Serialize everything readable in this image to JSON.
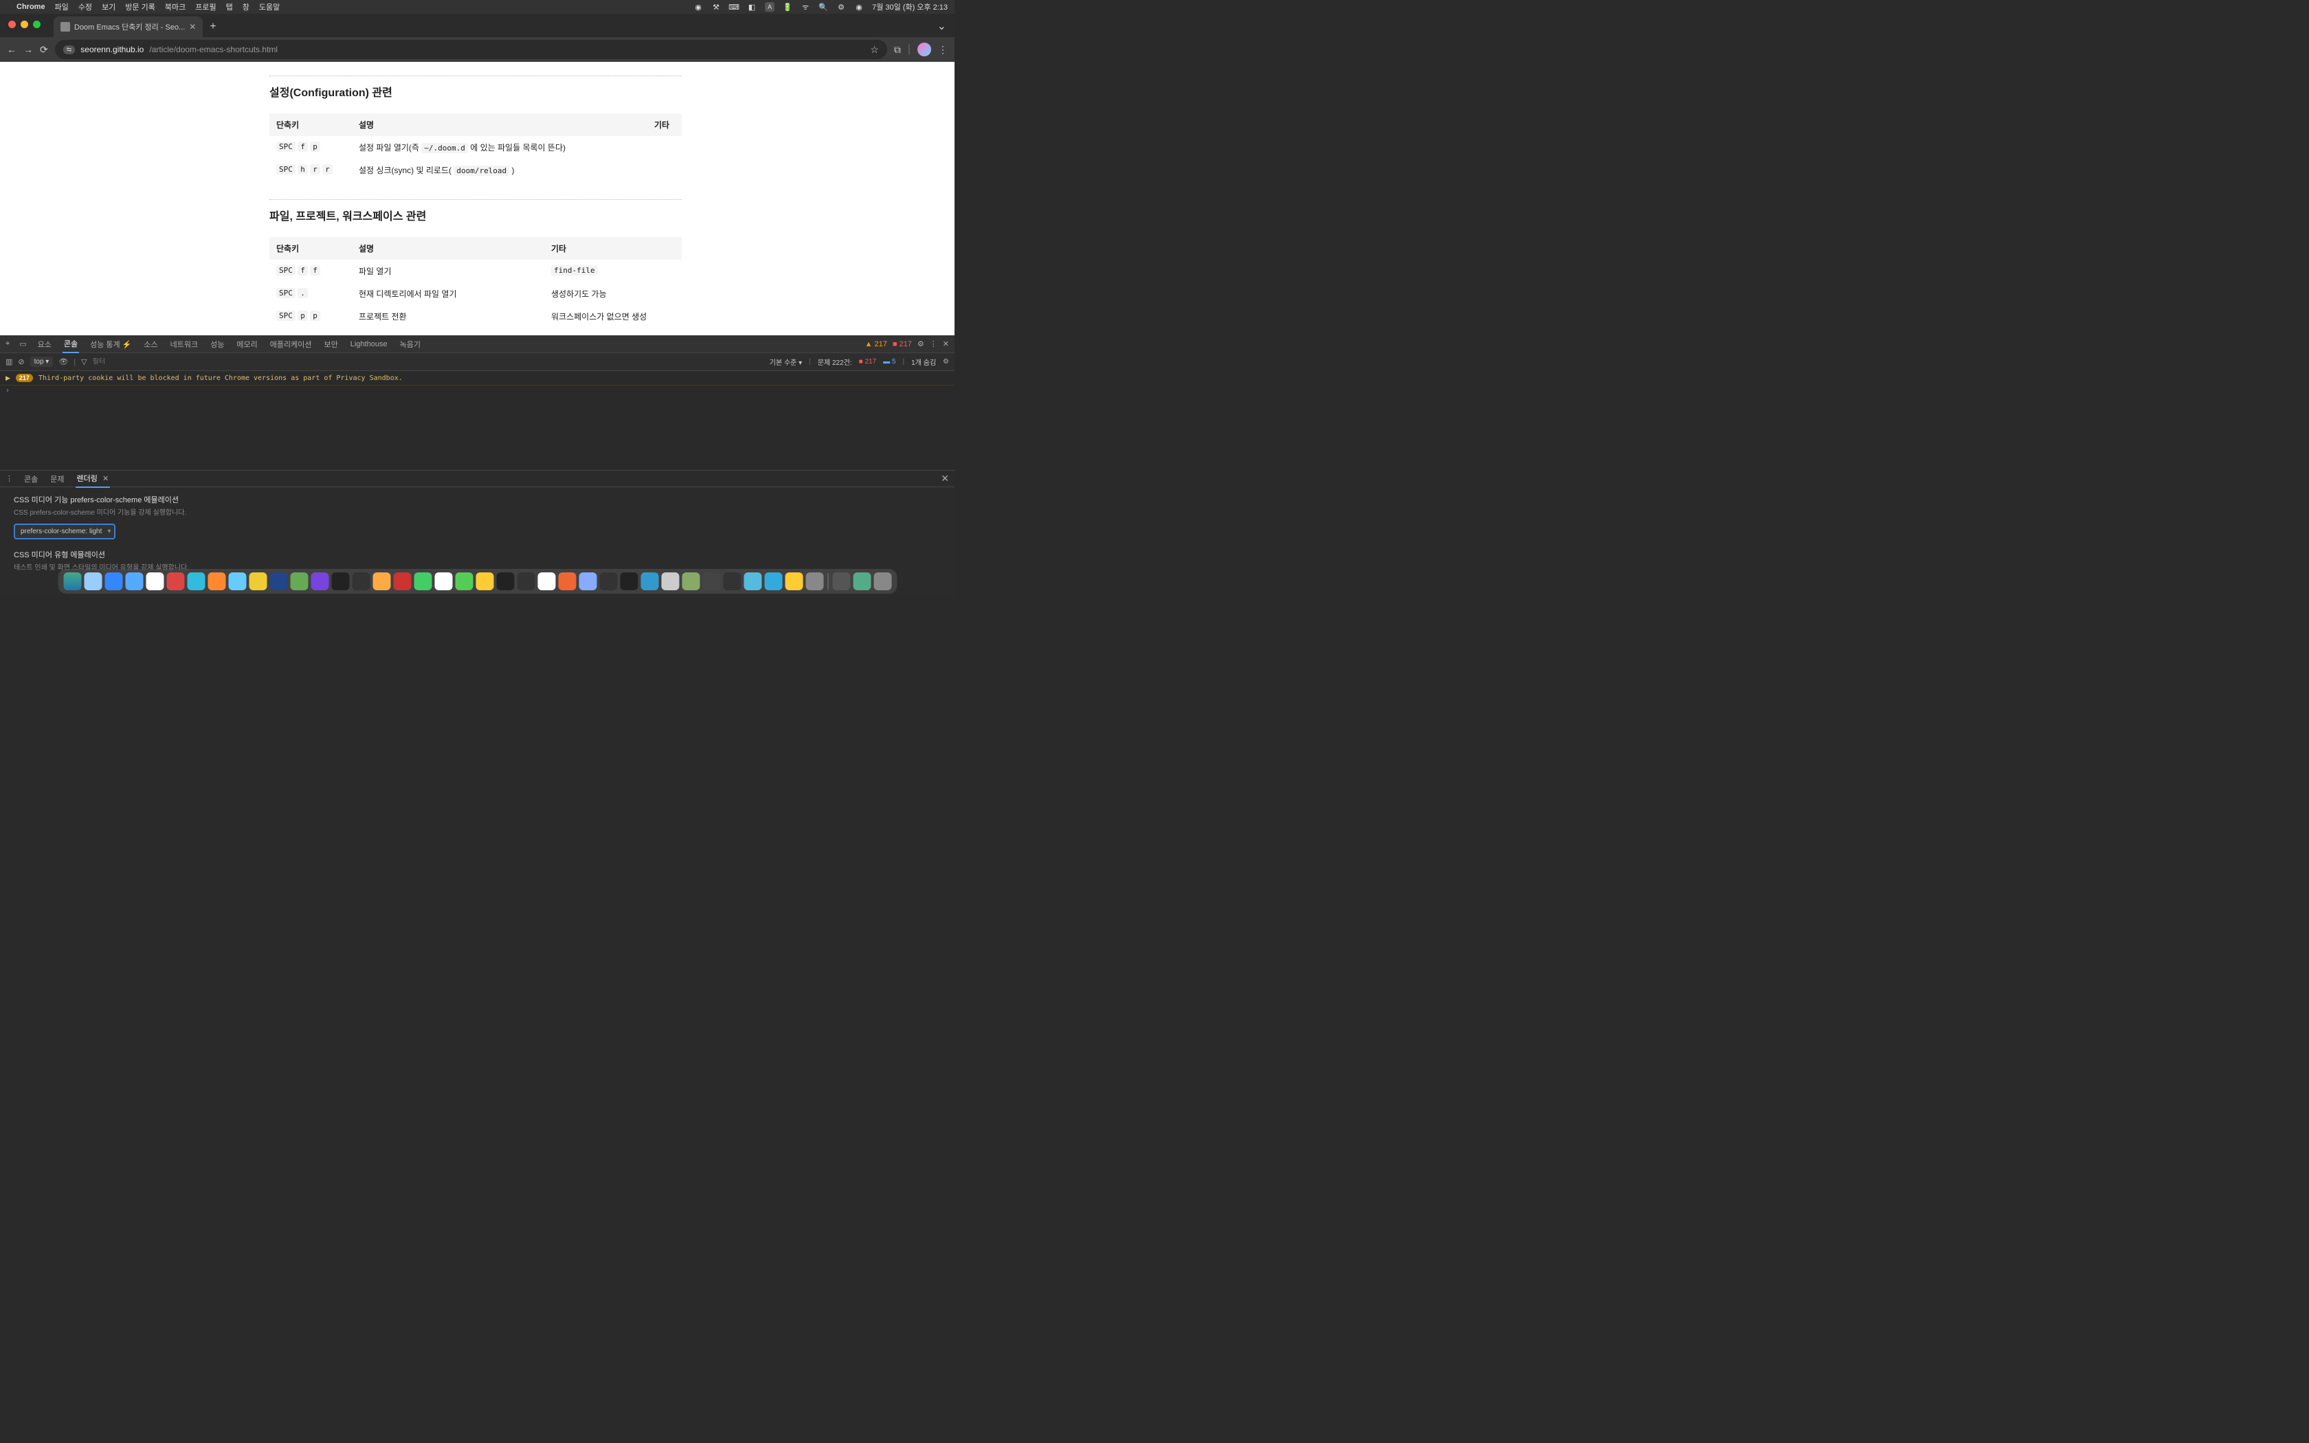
{
  "macos_menubar": {
    "app": "Chrome",
    "items": [
      "파일",
      "수정",
      "보기",
      "방문 기록",
      "북마크",
      "프로필",
      "탭",
      "창",
      "도움말"
    ],
    "clock": "7월 30일 (화) 오후 2:13",
    "input_badge": "A"
  },
  "browser": {
    "tab_title": "Doom Emacs 단축키 정리 - Seo...",
    "url_host": "seorenn.github.io",
    "url_path": "/article/doom-emacs-shortcuts.html"
  },
  "page": {
    "section1_title": "설정(Configuration) 관련",
    "section2_title": "파일, 프로젝트, 워크스페이스 관련",
    "table_headers": {
      "shortcut": "단축키",
      "desc": "설명",
      "misc": "기타"
    },
    "t1": [
      {
        "k_pre": "SPC",
        "k1": "f",
        "k2": "p",
        "d_pre": "설정 파일 열기(즉 ",
        "d_code": "~/.doom.d",
        "d_post": " 에 있는 파일들 목록이 뜬다)",
        "m": ""
      },
      {
        "k_pre": "SPC",
        "k1": "h",
        "k2": "r",
        "k3": "r",
        "d_pre": "설정 싱크(sync) 및 리로드( ",
        "d_code": "doom/reload",
        "d_post": " )",
        "m": ""
      }
    ],
    "t2": [
      {
        "k_pre": "SPC",
        "k1": "f",
        "k2": "f",
        "d": "파일 열기",
        "m_code": "find-file"
      },
      {
        "k_pre": "SPC",
        "k1": ".",
        "d": "현재 디렉토리에서 파일 열기",
        "m": "생성하기도 가능"
      },
      {
        "k_pre": "SPC",
        "k1": "p",
        "k2": "p",
        "d": "프로젝트 전환",
        "m": "워크스페이스가 없으면 생성"
      }
    ]
  },
  "devtools": {
    "tabs": [
      "요소",
      "콘솔",
      "성능 통계 ⚡",
      "소스",
      "네트워크",
      "성능",
      "메모리",
      "애플리케이션",
      "보안",
      "Lighthouse",
      "녹음기"
    ],
    "active_tab": "콘솔",
    "warn_count": "217",
    "err_count": "217",
    "sub": {
      "context": "top ▾",
      "filter_placeholder": "필터",
      "default_label": "기본 수준 ▾",
      "problems_prefix": "문제 222건:",
      "problems_err": "217",
      "problems_msg": "5",
      "hidden": "1개 숨김"
    },
    "msg_badge": "217",
    "msg_text": "Third-party cookie will be blocked in future Chrome versions as part of Privacy Sandbox.",
    "drawer_tabs": [
      "콘솔",
      "문제",
      "렌더링"
    ],
    "drawer_active": "렌더링",
    "rendering": {
      "s1_title": "CSS 미디어 기능 prefers-color-scheme 에뮬레이션",
      "s1_desc": "CSS prefers-color-scheme 미디어 기능을 강제 실행합니다.",
      "select_value": "prefers-color-scheme: light",
      "s2_title": "CSS 미디어 유형 에뮬레이션",
      "s2_desc": "테스트 인쇄 및 화면 스타일의 미디어 유형을 강제 실행합니다."
    }
  }
}
